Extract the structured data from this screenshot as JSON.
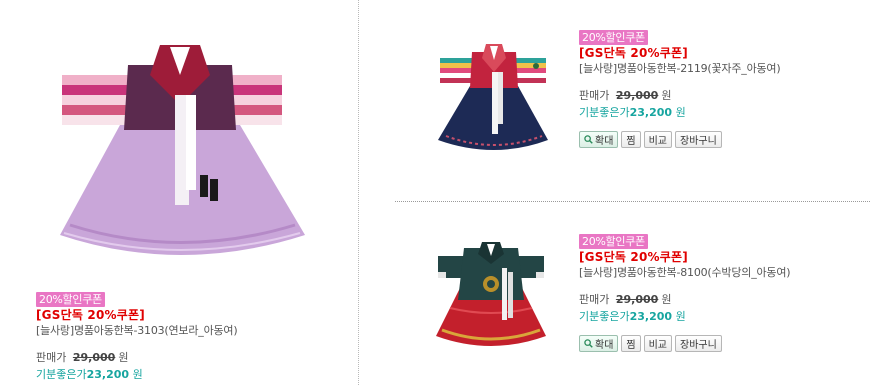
{
  "products": [
    {
      "coupon_badge": "20%할인쿠폰",
      "promo": "[GS단독 20%쿠폰]",
      "name": "[늘사랑]명품아동한복-3103(연보라_아동여)",
      "price_label": "판매가",
      "original_price": "29,000",
      "currency": "원",
      "sale_label": "기분좋은가",
      "sale_price": "23,200",
      "sale_currency": "원",
      "colors": {
        "main": "#c9a6d9",
        "jacket": "#5b2a4e",
        "collar": "#9e1c39"
      }
    },
    {
      "coupon_badge": "20%할인쿠폰",
      "promo": "[GS단독 20%쿠폰]",
      "name": "[늘사랑]명품아동한복-2119(꽃자주_아동여)",
      "price_label": "판매가",
      "original_price": "29,000",
      "currency": "원",
      "sale_label": "기분좋은가",
      "sale_price": "23,200",
      "sale_currency": "원",
      "buttons": {
        "zoom": "확대",
        "wish": "찜",
        "compare": "비교",
        "cart": "장바구니"
      },
      "colors": {
        "main": "#1d2a55",
        "jacket": "#c2233e",
        "collar": "#d94a5b"
      }
    },
    {
      "coupon_badge": "20%할인쿠폰",
      "promo": "[GS단독 20%쿠폰]",
      "name": "[늘사랑]명품아동한복-8100(수박당의_아동여)",
      "price_label": "판매가",
      "original_price": "29,000",
      "currency": "원",
      "sale_label": "기분좋은가",
      "sale_price": "23,200",
      "sale_currency": "원",
      "buttons": {
        "zoom": "확대",
        "wish": "찜",
        "compare": "비교",
        "cart": "장바구니"
      },
      "colors": {
        "main": "#c3202c",
        "jacket": "#234545",
        "collar": "#b98f2a"
      }
    }
  ]
}
